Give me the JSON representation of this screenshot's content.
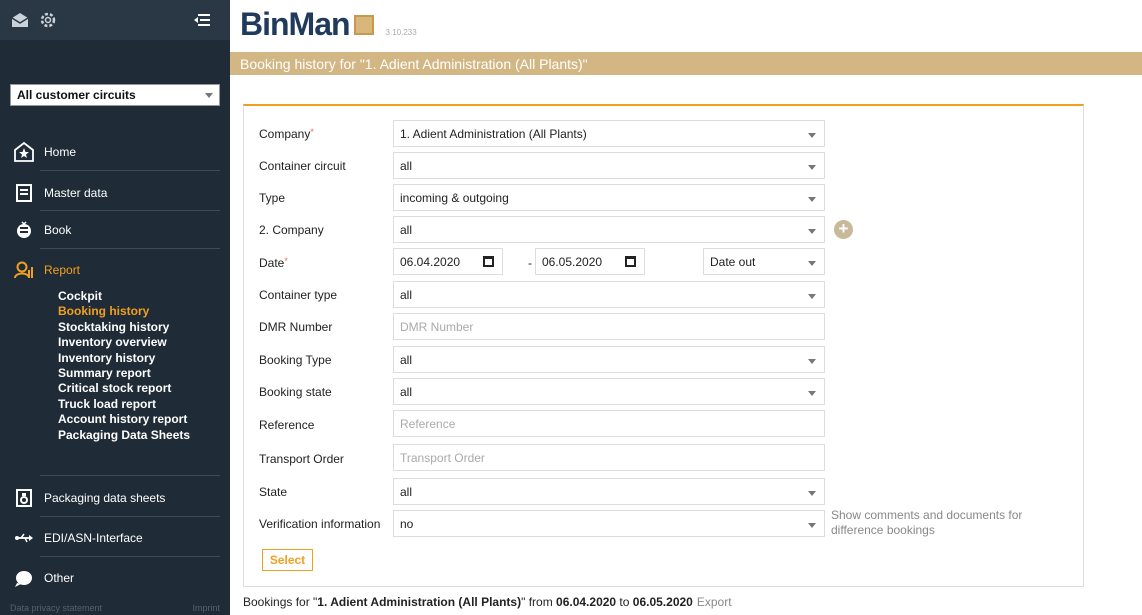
{
  "app": {
    "brand": "BinMan",
    "version": "3.10.233"
  },
  "sidebar": {
    "circuit_select": "All customer circuits",
    "nav": [
      {
        "label": "Home",
        "icon": "star-icon"
      },
      {
        "label": "Master data",
        "icon": "document-icon"
      },
      {
        "label": "Book",
        "icon": "book-icon"
      },
      {
        "label": "Report",
        "icon": "report-icon"
      },
      {
        "label": "Packaging data sheets",
        "icon": "packaging-icon"
      },
      {
        "label": "EDI/ASN-Interface",
        "icon": "usb-icon"
      },
      {
        "label": "Other",
        "icon": "other-icon"
      }
    ],
    "report_items": [
      "Cockpit",
      "Booking history",
      "Stocktaking history",
      "Inventory overview",
      "Inventory history",
      "Summary report",
      "Critical stock report",
      "Truck load report",
      "Account history report",
      "Packaging Data Sheets"
    ],
    "active_report_item": "Booking history",
    "footer": {
      "privacy": "Data privacy statement",
      "imprint": "Imprint"
    }
  },
  "page": {
    "title": "Booking history for \"1. Adient Administration (All Plants)\""
  },
  "form": {
    "company": {
      "label": "Company",
      "value": "1. Adient Administration (All Plants)"
    },
    "container_circuit": {
      "label": "Container circuit",
      "value": "all"
    },
    "type": {
      "label": "Type",
      "value": "incoming & outgoing"
    },
    "company2": {
      "label": "2. Company",
      "value": "all"
    },
    "date": {
      "label": "Date",
      "from": "06.04.2020",
      "sep": "-",
      "to": "06.05.2020",
      "mode": "Date out"
    },
    "container_type": {
      "label": "Container type",
      "value": "all"
    },
    "dmr": {
      "label": "DMR Number",
      "placeholder": "DMR Number"
    },
    "booking_type": {
      "label": "Booking Type",
      "value": "all"
    },
    "booking_state": {
      "label": "Booking state",
      "value": "all"
    },
    "reference": {
      "label": "Reference",
      "placeholder": "Reference"
    },
    "transport_order": {
      "label": "Transport Order",
      "placeholder": "Transport Order"
    },
    "state": {
      "label": "State",
      "value": "all"
    },
    "verification": {
      "label": "Verification information",
      "value": "no",
      "note": "Show comments and documents for difference bookings"
    },
    "select_label": "Select"
  },
  "result": {
    "prefix": "Bookings for \"",
    "company": "1. Adient Administration (All Plants)",
    "mid": "\" from ",
    "from": "06.04.2020",
    "to_word": " to ",
    "to": "06.05.2020",
    "export": "Export"
  },
  "colors": {
    "accent": "#f0a01e",
    "sidebar": "#1f2b36",
    "title_bar": "#d2b683"
  }
}
